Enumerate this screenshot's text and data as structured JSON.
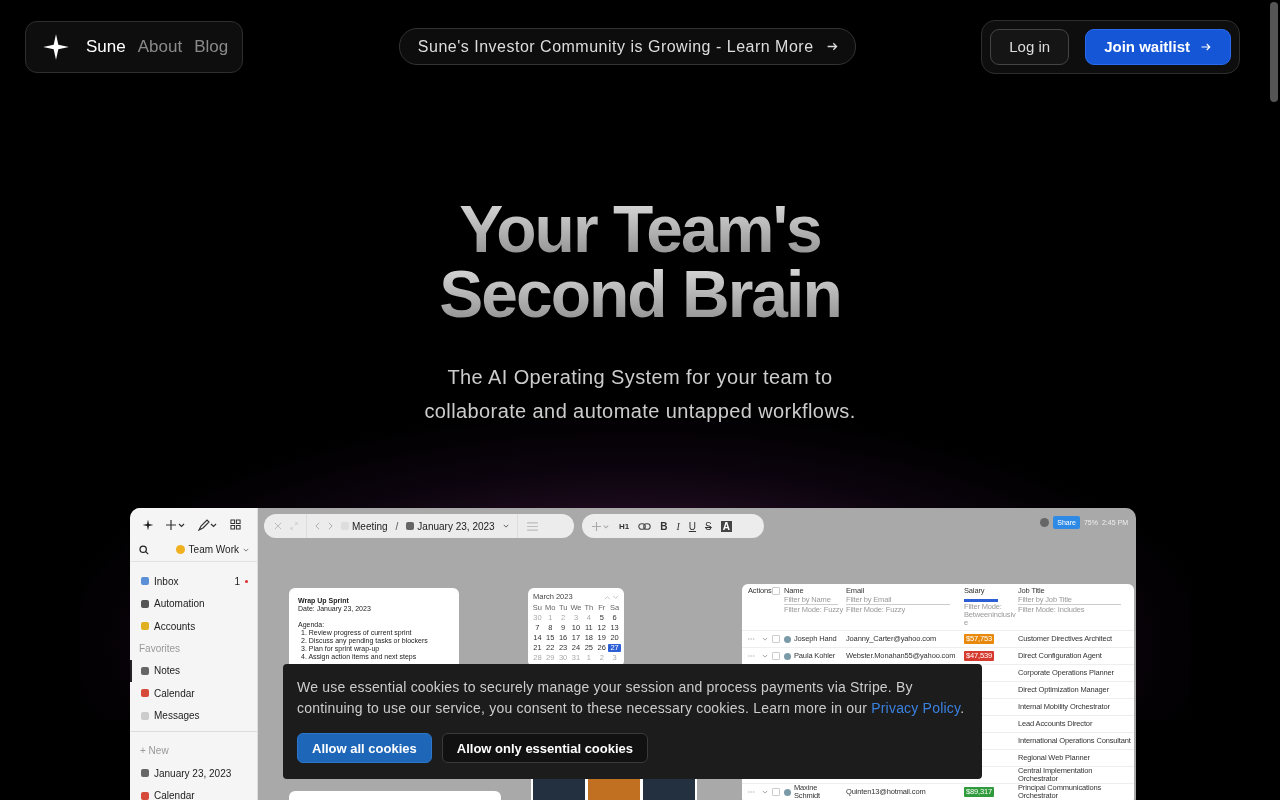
{
  "nav": {
    "brand": "Sune",
    "links": [
      {
        "label": "About"
      },
      {
        "label": "Blog"
      }
    ]
  },
  "announcement": {
    "label": "Sune's Investor Community is Growing - Learn More"
  },
  "actions": [
    {
      "label": "Log in",
      "kind": "secondary"
    },
    {
      "label": "Join waitlist",
      "kind": "primary"
    }
  ],
  "hero": {
    "title_lines": [
      "Your Team's",
      "Second Brain"
    ],
    "subtitle_lines": [
      "The AI Operating System for your team to",
      "collaborate and automate untapped workflows."
    ]
  },
  "app": {
    "workspace": "Team Work",
    "sidebar": {
      "items": [
        {
          "label": "Inbox",
          "count": "1",
          "unread": true
        },
        {
          "label": "Automation",
          "unread": false
        },
        {
          "label": "Accounts",
          "unread": false
        }
      ],
      "favorites_heading": "Favorites",
      "favorites": [
        {
          "label": "Notes",
          "selected": true
        },
        {
          "label": "Calendar",
          "selected": false
        },
        {
          "label": "Messages",
          "selected": false
        }
      ],
      "new_label": "+ New",
      "pages": [
        {
          "label": "January 23, 2023"
        },
        {
          "label": "Calendar"
        }
      ]
    },
    "breadcrumb": [
      "Meeting",
      "January 23, 2023"
    ],
    "breadcrumb_separator": "/",
    "format_buttons": [
      {
        "label": "H1",
        "kind": "heading"
      },
      {
        "label": "B",
        "kind": "bold"
      },
      {
        "label": "I",
        "kind": "italic"
      },
      {
        "label": "U",
        "kind": "underline"
      },
      {
        "label": "S",
        "kind": "strike"
      },
      {
        "label": "A",
        "kind": "highlight"
      }
    ],
    "status": {
      "share": "Share",
      "zoom": "75%",
      "time": "2:45 PM"
    },
    "note": {
      "title": "Wrap Up Sprint",
      "date": "Date: January 23, 2023",
      "agenda_heading": "Agenda:",
      "items": [
        "1. Review progress of current sprint",
        "2. Discuss any pending tasks or blockers",
        "3. Plan for sprint wrap-up",
        "4. Assign action items and next steps"
      ]
    },
    "calendar": {
      "month": "March 2023",
      "weekdays": [
        "Su",
        "Mo",
        "Tu",
        "We",
        "Th",
        "Fr",
        "Sa"
      ],
      "weeks": [
        [
          {
            "day": "30",
            "muted": true,
            "selected": false
          },
          {
            "day": "1",
            "muted": true,
            "selected": false
          },
          {
            "day": "2",
            "muted": true,
            "selected": false
          },
          {
            "day": "3",
            "muted": true,
            "selected": false
          },
          {
            "day": "4",
            "muted": true,
            "selected": false
          },
          {
            "day": "5",
            "muted": false,
            "selected": false
          },
          {
            "day": "6",
            "muted": false,
            "selected": false
          }
        ],
        [
          {
            "day": "7",
            "muted": false,
            "selected": false
          },
          {
            "day": "8",
            "muted": false,
            "selected": false
          },
          {
            "day": "9",
            "muted": false,
            "selected": false
          },
          {
            "day": "10",
            "muted": false,
            "selected": false
          },
          {
            "day": "11",
            "muted": false,
            "selected": false
          },
          {
            "day": "12",
            "muted": false,
            "selected": false
          },
          {
            "day": "13",
            "muted": false,
            "selected": false
          }
        ],
        [
          {
            "day": "14",
            "muted": false,
            "selected": false
          },
          {
            "day": "15",
            "muted": false,
            "selected": false
          },
          {
            "day": "16",
            "muted": false,
            "selected": false
          },
          {
            "day": "17",
            "muted": false,
            "selected": false
          },
          {
            "day": "18",
            "muted": false,
            "selected": false
          },
          {
            "day": "19",
            "muted": false,
            "selected": false
          },
          {
            "day": "20",
            "muted": false,
            "selected": false
          }
        ],
        [
          {
            "day": "21",
            "muted": false,
            "selected": false
          },
          {
            "day": "22",
            "muted": false,
            "selected": false
          },
          {
            "day": "23",
            "muted": false,
            "selected": false
          },
          {
            "day": "24",
            "muted": false,
            "selected": false
          },
          {
            "day": "25",
            "muted": false,
            "selected": false
          },
          {
            "day": "26",
            "muted": false,
            "selected": false
          },
          {
            "day": "27",
            "muted": false,
            "selected": true
          }
        ],
        [
          {
            "day": "28",
            "muted": true,
            "selected": false
          },
          {
            "day": "29",
            "muted": true,
            "selected": false
          },
          {
            "day": "30",
            "muted": true,
            "selected": false
          },
          {
            "day": "31",
            "muted": true,
            "selected": false
          },
          {
            "day": "1",
            "muted": true,
            "selected": false
          },
          {
            "day": "2",
            "muted": true,
            "selected": false
          },
          {
            "day": "3",
            "muted": true,
            "selected": false
          }
        ]
      ]
    },
    "table": {
      "all_selected": false,
      "columns": [
        {
          "label": "Actions"
        },
        {
          "label": "Name",
          "filter": "Filter by Name",
          "mode": "Filter Mode: Fuzzy"
        },
        {
          "label": "Email",
          "filter": "Filter by Email",
          "mode": "Filter Mode: Fuzzy"
        },
        {
          "label": "Salary",
          "level": 1,
          "mode": "Filter Mode: Betweeninclusive"
        },
        {
          "label": "Job Title",
          "filter": "Filter by Job Title",
          "mode": "Filter Mode: Includes"
        }
      ],
      "rows": [
        {
          "selected": false,
          "name": "Joseph Hand",
          "email": "Joanny_Carter@yahoo.com",
          "salary": "$57,753",
          "color": "#e8890c",
          "job": "Customer Directives Architect"
        },
        {
          "selected": false,
          "name": "Paula Kohler",
          "email": "Webster.Monahan55@yahoo.com",
          "salary": "$47,539",
          "color": "#d63a2f",
          "job": "Direct Configuration Agent"
        },
        {
          "job": "Corporate Operations Planner"
        },
        {
          "job": "Direct Optimization Manager"
        },
        {
          "job": "Internal Mobility Orchestrator"
        },
        {
          "job": "Lead Accounts Director"
        },
        {
          "job": "International Operations Consultant"
        },
        {
          "job": "Regional Web Planner"
        },
        {
          "job": "Central Implementation Orchestrator"
        },
        {
          "selected": false,
          "name": "Maxine Schmidt",
          "email": "Quinten13@hotmail.com",
          "salary": "$89,317",
          "color": "#2f9b3c",
          "job": "Principal Communications Orchestrator"
        }
      ]
    }
  },
  "cookie_banner": {
    "text_before": "We use essential cookies to securely manage your session and process payments via Stripe. By continuing to use our service, you consent to these necessary cookies. Learn more in our ",
    "link": "Privacy Policy",
    "text_after": ".",
    "buttons": [
      {
        "label": "Allow all cookies",
        "kind": "primary"
      },
      {
        "label": "Allow only essential cookies",
        "kind": "secondary"
      }
    ]
  }
}
